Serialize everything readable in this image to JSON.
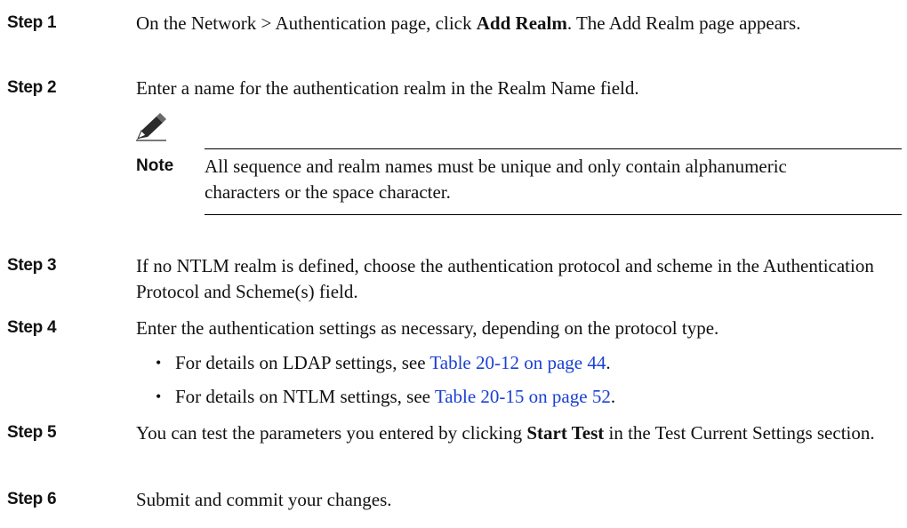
{
  "steps": [
    {
      "label": "Step 1",
      "text_parts": [
        "On the Network > Authentication page, click ",
        "Add Realm",
        ". The Add Realm page appears."
      ]
    },
    {
      "label": "Step 2",
      "text": "Enter a name for the authentication realm in the Realm Name field."
    },
    {
      "label": "Step 3",
      "text": "If no NTLM realm is defined, choose the authentication protocol and scheme in the Authentication Protocol and Scheme(s) field."
    },
    {
      "label": "Step 4",
      "text": "Enter the authentication settings as necessary, depending on the protocol type."
    },
    {
      "label": "Step 5",
      "text_parts": [
        "You can test the parameters you entered by clicking ",
        "Start Test",
        " in the Test Current Settings section."
      ]
    },
    {
      "label": "Step 6",
      "text": "Submit and commit your changes."
    }
  ],
  "note": {
    "label": "Note",
    "text": "All sequence and realm names must be unique and only contain alphanumeric characters or the space character.",
    "icon": "pencil-note-icon"
  },
  "bullets": [
    {
      "prefix": "For details on LDAP settings, see ",
      "link": "Table 20-12 on page 44",
      "suffix": "."
    },
    {
      "prefix": "For details on NTLM settings, see ",
      "link": "Table 20-15 on page 52",
      "suffix": "."
    }
  ]
}
